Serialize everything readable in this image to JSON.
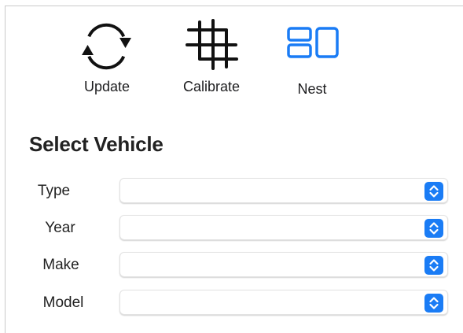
{
  "toolbar": {
    "update": {
      "label": "Update",
      "icon": "refresh-icon"
    },
    "calibrate": {
      "label": "Calibrate",
      "icon": "crop-icon"
    },
    "nest": {
      "label": "Nest",
      "icon": "nest-layout-icon",
      "color": "#1a7cf5"
    }
  },
  "vehicle": {
    "title": "Select Vehicle",
    "fields": [
      {
        "label": "Type",
        "value": ""
      },
      {
        "label": "Year",
        "value": ""
      },
      {
        "label": "Make",
        "value": ""
      },
      {
        "label": "Model",
        "value": ""
      }
    ]
  },
  "colors": {
    "accent": "#1a7cf5",
    "text": "#222222",
    "divider": "#c9c9c9"
  }
}
